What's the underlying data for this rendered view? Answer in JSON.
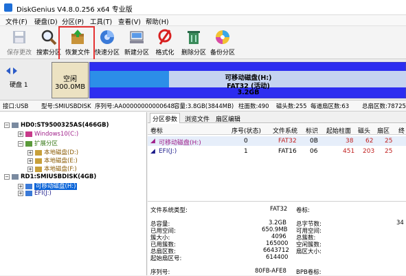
{
  "window": {
    "title": "DiskGenius V4.8.0.256 x64 专业版"
  },
  "menu": [
    "文件(F)",
    "硬盘(D)",
    "分区(P)",
    "工具(T)",
    "查看(V)",
    "帮助(H)"
  ],
  "toolbar": [
    {
      "label": "保存更改",
      "icon": "save-icon",
      "enabled": false
    },
    {
      "label": "搜索分区",
      "icon": "magnifier-icon",
      "enabled": true
    },
    {
      "label": "恢复文件",
      "icon": "recover-files-icon",
      "enabled": true
    },
    {
      "label": "快速分区",
      "icon": "quick-partition-icon",
      "enabled": true
    },
    {
      "label": "新建分区",
      "icon": "new-partition-icon",
      "enabled": true
    },
    {
      "label": "格式化",
      "icon": "format-icon",
      "enabled": true
    },
    {
      "label": "删除分区",
      "icon": "delete-partition-icon",
      "enabled": true
    },
    {
      "label": "备份分区",
      "icon": "backup-partition-icon",
      "enabled": true
    }
  ],
  "diskmap": {
    "disk_label": "硬盘 1",
    "free": {
      "line1": "空闲",
      "line2": "300.0MB"
    },
    "partition": {
      "name": "可移动磁盘(H:)",
      "fs": "FAT32 (活动)",
      "size": "3.2GB"
    }
  },
  "infobar": {
    "iface": "接口:USB",
    "model": "型号:SMIUSBDISK",
    "serial": "序列号:AA00000000000648",
    "capacity": "容量:3.8GB(3844MB)",
    "cylinders": "柱面数:490",
    "heads": "磁头数:255",
    "sectors_per_track": "每道扇区数:63",
    "total_sectors": "总扇区数:78725"
  },
  "tree": {
    "disk0": "HD0:ST9500325AS(466GB)",
    "windows": "Windows10(C:)",
    "extended": "扩展分区",
    "local_d": "本地磁盘(D:)",
    "local_e": "本地磁盘(E:)",
    "local_f": "本地磁盘(F:)",
    "disk1": "RD1:SMIUSBDISK(4GB)",
    "removable_h": "可移动磁盘(H:)",
    "efi_j": "EFI(J:)"
  },
  "tabs": [
    "分区参数",
    "浏览文件",
    "扇区编辑"
  ],
  "table": {
    "headers": [
      "卷标",
      "序号(状态)",
      "文件系统",
      "标识",
      "起始柱面",
      "磁头",
      "扇区",
      "终"
    ],
    "rows": [
      {
        "label": "可移动磁盘(H:)",
        "index": "0",
        "fs": "FAT32",
        "id": "0B",
        "start_cyl": "38",
        "head": "62",
        "sector": "25"
      },
      {
        "label": "EFI(J:)",
        "index": "1",
        "fs": "FAT16",
        "id": "06",
        "start_cyl": "451",
        "head": "203",
        "sector": "25"
      }
    ]
  },
  "details": {
    "fs_type_label": "文件系统类型:",
    "fs_type_value": "FAT32",
    "vol_label": "卷标:",
    "total_label": "总容量:",
    "total_value": "3.2GB",
    "total_bytes_label": "总字节数:",
    "total_bytes_value": "34",
    "used_label": "已用空间:",
    "used_value": "650.9MB",
    "free_label": "可用空间:",
    "cluster_label": "簇大小:",
    "cluster_value": "4096",
    "total_clusters_label": "总簇数:",
    "used_clusters_label": "已用簇数:",
    "used_clusters_value": "165000",
    "free_clusters_label": "空闲簇数:",
    "total_sectors_label": "总扇区数:",
    "total_sectors_value": "6643712",
    "sector_size_label": "扇区大小:",
    "start_sector_label": "起始扇区号:",
    "start_sector_value": "614400",
    "serial_label": "序列号:",
    "serial_value": "80FB-AFE8",
    "bpb_label": "BPB卷标:"
  }
}
